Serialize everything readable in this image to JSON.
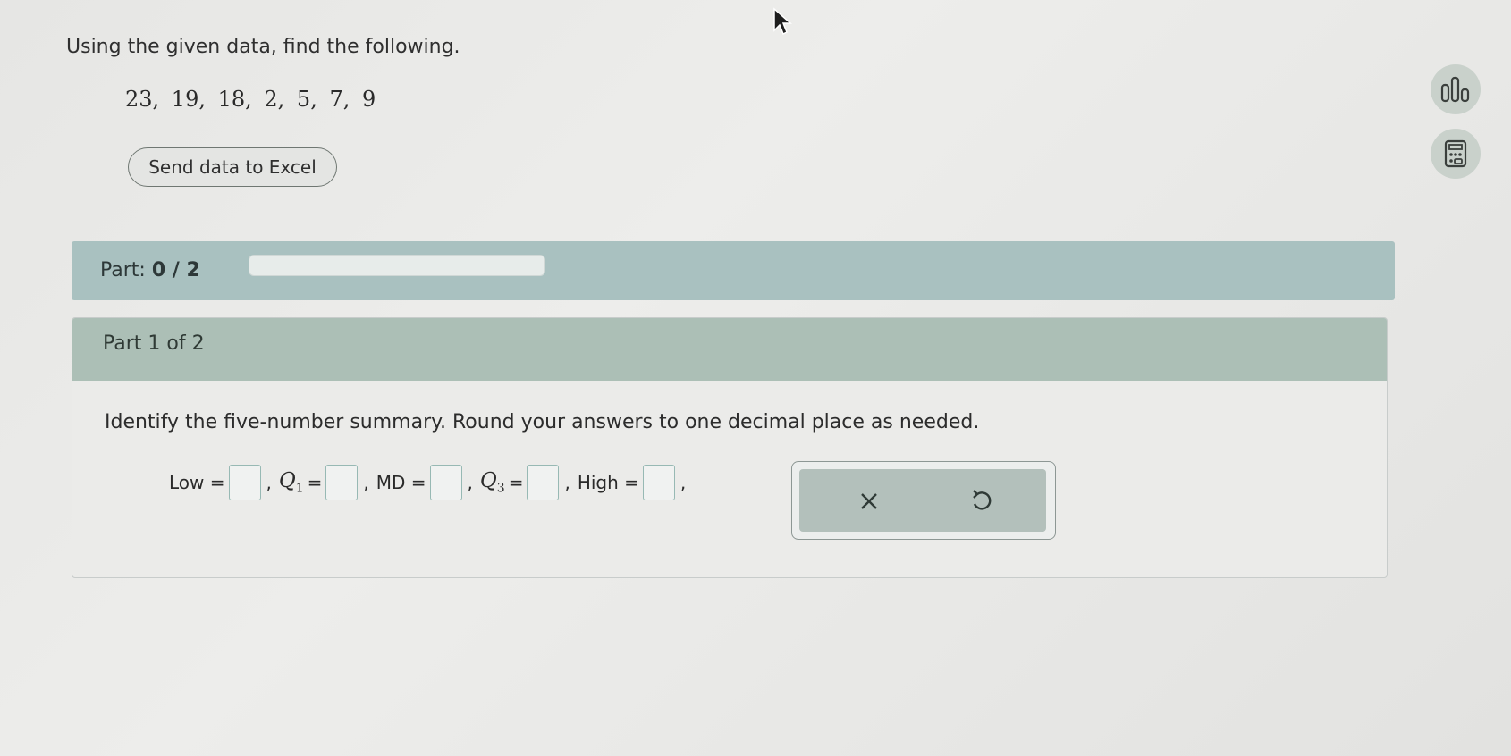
{
  "question": {
    "prompt": "Using the given data, find the following.",
    "dataset": "23,  19,  18,  2,  5,  7,  9"
  },
  "excel_button": {
    "label": "Send data to Excel"
  },
  "side_tools": [
    {
      "icon": "bar-chart-icon"
    },
    {
      "icon": "calculator-icon"
    }
  ],
  "part_progress": {
    "label": "Part:",
    "value": "0 / 2",
    "fraction": 0
  },
  "card": {
    "header": "Part 1 of 2",
    "instructions": "Identify the five-number summary. Round your answers to one decimal place as needed.",
    "answers": {
      "low_label": "Low =",
      "q1_symbol": "Q",
      "q1_sub": "1",
      "md_label": "MD =",
      "q3_symbol": "Q",
      "q3_sub": "3",
      "high_label": "High =",
      "eq": "=",
      "comma": ","
    },
    "actions": {
      "clear_icon": "close-icon",
      "undo_icon": "undo-icon"
    }
  }
}
